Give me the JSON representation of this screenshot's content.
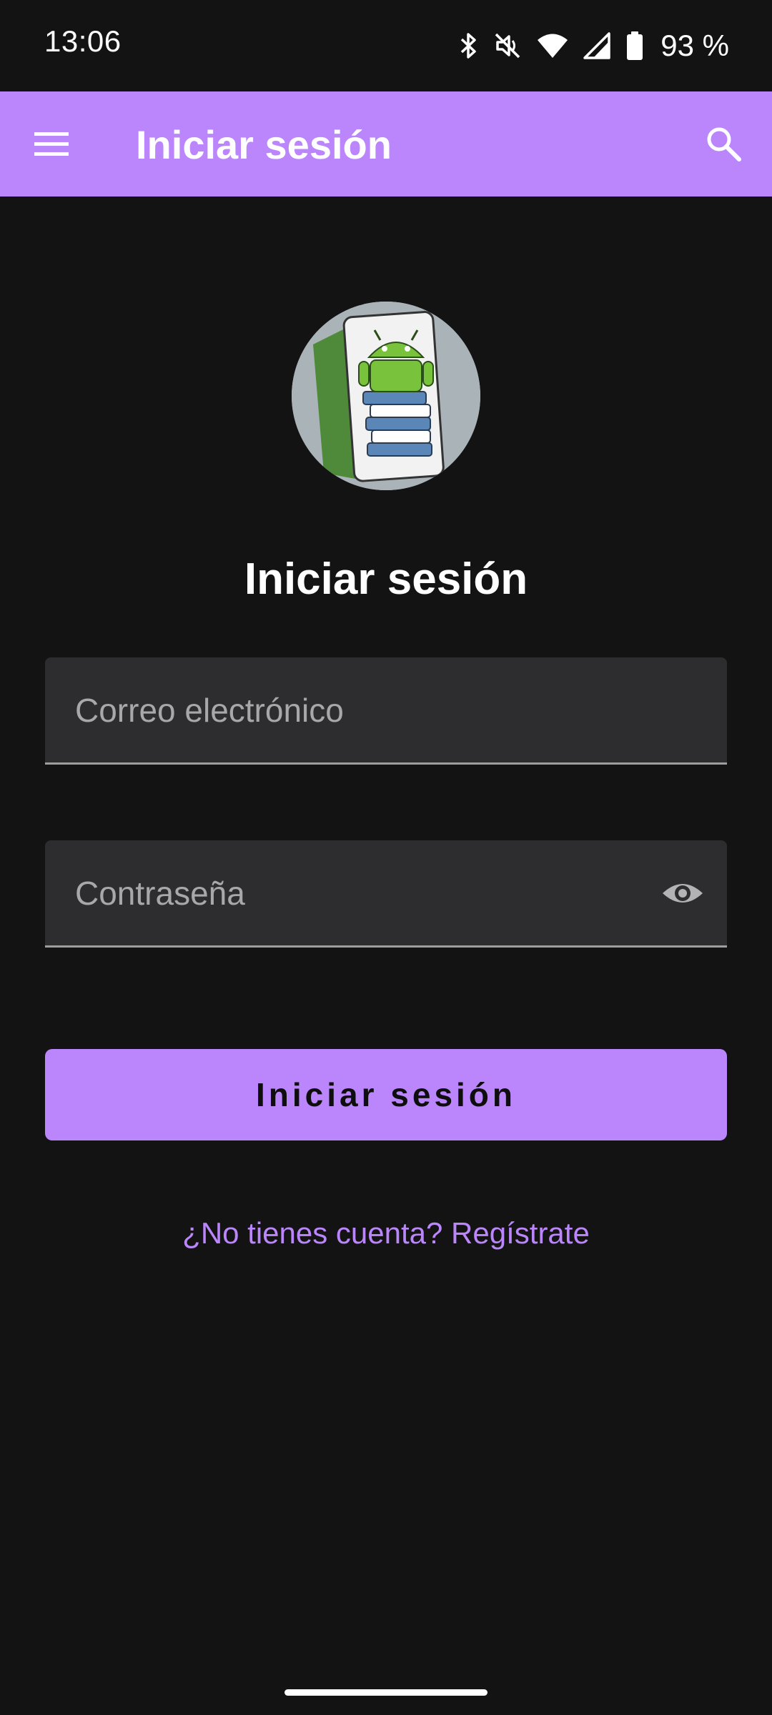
{
  "status_bar": {
    "time": "13:06",
    "battery_text": "93 %",
    "icons": [
      "bluetooth-icon",
      "mute-icon",
      "wifi-icon",
      "cell-signal-icon",
      "battery-icon"
    ]
  },
  "app_bar": {
    "title": "Iniciar sesión",
    "menu_icon": "menu-icon",
    "search_icon": "search-icon",
    "color": "#bb86fc"
  },
  "login": {
    "heading": "Iniciar sesión",
    "email_placeholder": "Correo electrónico",
    "email_value": "",
    "password_placeholder": "Contraseña",
    "password_value": "",
    "password_toggle_icon": "eye-icon",
    "submit_label": "Iniciar sesión",
    "register_link": "¿No tienes cuenta? Regístrate"
  },
  "colors": {
    "background": "#131314",
    "accent": "#bb86fc",
    "field_background": "#2d2d2f"
  }
}
